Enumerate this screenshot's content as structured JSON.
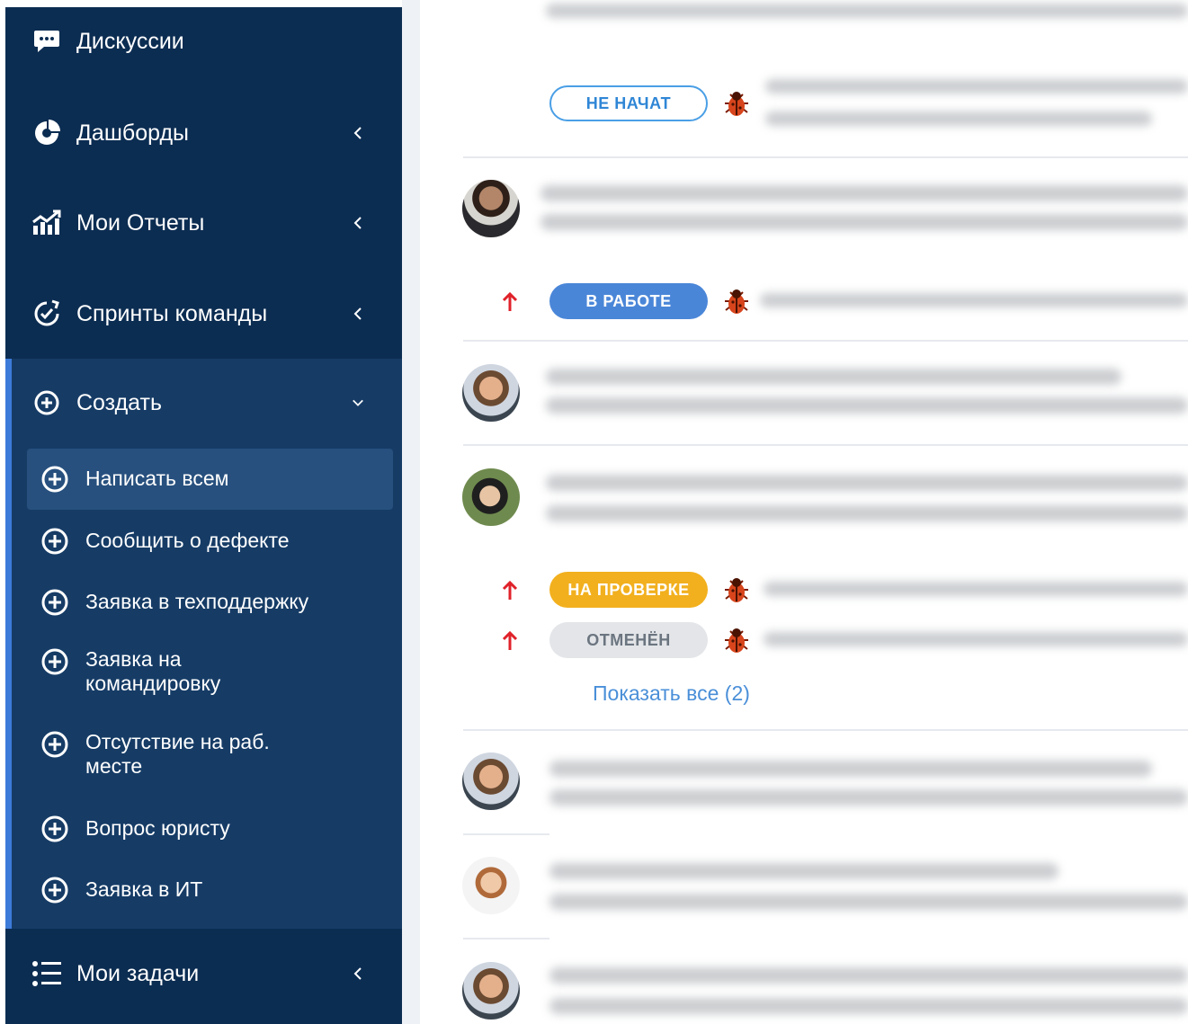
{
  "sidebar": {
    "items": [
      {
        "label": "Дискуссии",
        "icon": "chat-icon"
      },
      {
        "label": "Дашборды",
        "icon": "pie-chart-icon"
      },
      {
        "label": "Мои Отчеты",
        "icon": "reports-chart-icon"
      },
      {
        "label": "Спринты команды",
        "icon": "sprint-cycle-icon"
      },
      {
        "label": "Создать",
        "icon": "plus-circle-icon"
      },
      {
        "label": "Мои задачи",
        "icon": "list-icon"
      }
    ],
    "create_submenu": [
      {
        "label": "Написать всем",
        "active": true
      },
      {
        "label": "Сообщить о дефекте"
      },
      {
        "label": "Заявка в техподдержку"
      },
      {
        "label": "Заявка на командировку"
      },
      {
        "label": "Отсутствие на раб. месте"
      },
      {
        "label": "Вопрос юристу"
      },
      {
        "label": "Заявка в ИТ"
      }
    ]
  },
  "feed": {
    "statuses": {
      "not_started": "НЕ НАЧАТ",
      "in_progress": "В РАБОТЕ",
      "in_review": "НА ПРОВЕРКЕ",
      "cancelled": "ОТМЕНЁН"
    },
    "show_all": "Показать все (2)"
  },
  "colors": {
    "sidebar_bg": "#0c2d52",
    "submenu_bg": "#163c66",
    "accent": "#3d7bd9",
    "badge_not_started": "#4a9fe6",
    "badge_in_progress": "#4a86d8",
    "badge_in_review": "#f2b01e",
    "badge_cancelled": "#e3e5e8",
    "priority_arrow": "#e0222a"
  }
}
